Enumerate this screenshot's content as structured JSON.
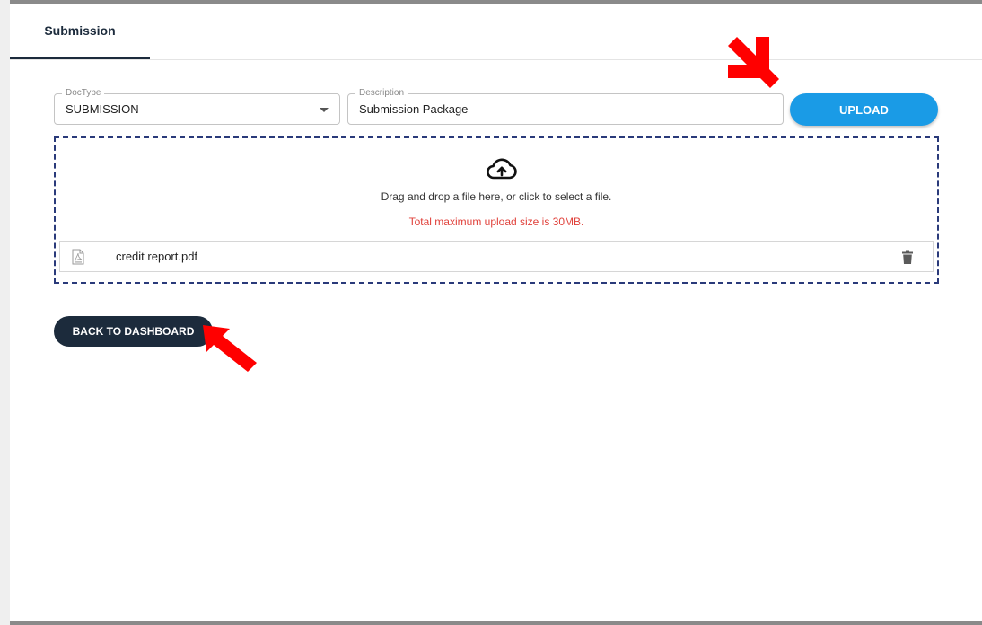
{
  "tabs": [
    {
      "label": "Submission",
      "active": true
    }
  ],
  "form": {
    "doctype": {
      "legend": "DocType",
      "value": "SUBMISSION"
    },
    "description": {
      "legend": "Description",
      "value": "Submission Package"
    },
    "upload_label": "UPLOAD"
  },
  "dropzone": {
    "icon": "cloud-upload-icon",
    "instruction": "Drag and drop a file here, or click to select a file.",
    "limit_text": "Total maximum upload size is 30MB.",
    "files": [
      {
        "name": "credit report.pdf",
        "icon": "pdf-file-icon"
      }
    ]
  },
  "actions": {
    "back_label": "BACK TO DASHBOARD"
  },
  "colors": {
    "primary_dark": "#1c2b3c",
    "upload_blue": "#1a9be6",
    "warning_red": "#e0403a",
    "dropzone_border": "#2a3a7a",
    "annotation_arrow": "#ff0000"
  }
}
